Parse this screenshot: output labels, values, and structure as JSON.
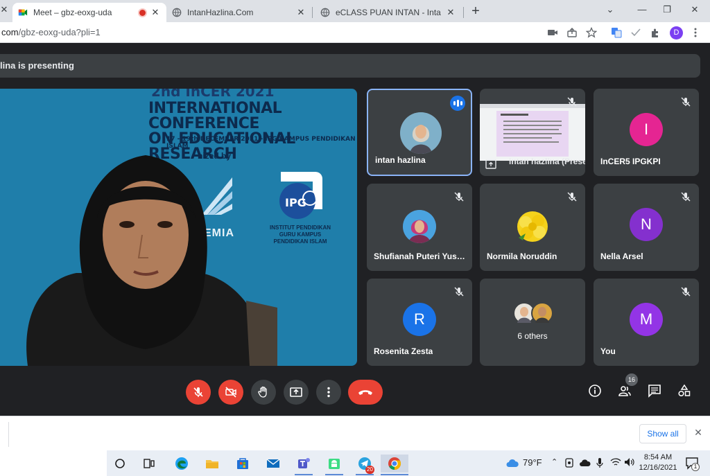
{
  "browser": {
    "tabs": [
      {
        "title": "Meet – gbz-eoxg-uda",
        "active": true,
        "recording": true
      },
      {
        "title": "IntanHazlina.Com",
        "active": false
      },
      {
        "title": "eCLASS PUAN INTAN - IntanHazli",
        "active": false
      }
    ],
    "url_host": "com",
    "url_path": "/gbz-eoxg-uda?pli=1",
    "profile_initial": "D",
    "profile_color": "#7b3ff2",
    "icons": [
      "camera-icon",
      "share-icon",
      "star-icon",
      "translate-icon",
      "check-icon",
      "extensions-icon",
      "menu-dots-icon"
    ]
  },
  "meet": {
    "presenting_banner": "lina is presenting",
    "main_slide": {
      "top_partial": "2nd InCER 2021",
      "title_line1": "INTERNATIONAL CONFERENCE",
      "title_line2": "ON EDUCATIONAL RESEARCH",
      "date_line": "17 - 19th DECEMBER 2021 - IPG KAMPUS PENDIDIKAN ISLAM",
      "organized_by": "nized by :",
      "academia_text": "EMIA",
      "ipg_logo_text": "IPG",
      "ipg_caption": "INSTITUT PENDIDIKAN GURU KAMPUS PENDIDIKAN ISLAM"
    },
    "participants": [
      {
        "name": "intan hazlina",
        "type": "photo",
        "speaking": true
      },
      {
        "name": "intan hazlina (Presentation)",
        "type": "screen",
        "muted": true
      },
      {
        "name": "InCER5 IPGKPI",
        "type": "initial",
        "initial": "I",
        "color": "#e52592",
        "muted": true
      },
      {
        "name": "Shufianah Puteri Yus…",
        "type": "photo",
        "muted": true
      },
      {
        "name": "Normila Noruddin",
        "type": "flower",
        "muted": true
      },
      {
        "name": "Nella Arsel",
        "type": "initial",
        "initial": "N",
        "color": "#8430ce",
        "muted": true
      },
      {
        "name": "Rosenita Zesta",
        "type": "initial",
        "initial": "R",
        "color": "#1a73e8",
        "muted": true
      },
      {
        "name": "6 others",
        "type": "others"
      },
      {
        "name": "You",
        "type": "initial",
        "initial": "M",
        "color": "#9334e6",
        "muted": true
      }
    ],
    "controls": [
      "mic-off",
      "camera-off",
      "raise-hand",
      "present",
      "more-options",
      "end-call"
    ],
    "side_controls": [
      "meeting-details",
      "people",
      "chat",
      "activities"
    ],
    "people_count": "16"
  },
  "download_shelf": {
    "show_all_label": "Show all"
  },
  "taskbar": {
    "apps": [
      "search",
      "task-view",
      "edge",
      "file-explorer",
      "store",
      "mail",
      "teams",
      "android",
      "telegram",
      "chrome"
    ],
    "telegram_badge": "20",
    "weather": "79°F",
    "time": "8:54 AM",
    "date": "12/16/2021",
    "notification_count": "1"
  }
}
